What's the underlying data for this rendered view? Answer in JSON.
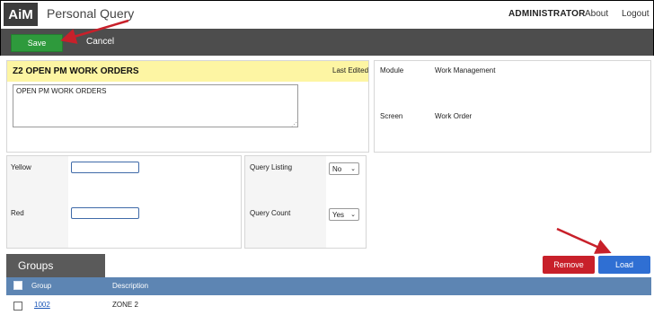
{
  "app": {
    "logo": "AiM",
    "title": "Personal Query",
    "user": "ADMINISTRATOR",
    "links": [
      "About",
      "Logout"
    ]
  },
  "toolbar": {
    "save_label": "Save",
    "cancel_label": "Cancel"
  },
  "query": {
    "title": "Z2 OPEN PM WORK ORDERS",
    "last_edited_label": "Last Edited",
    "description": "OPEN PM WORK ORDERS"
  },
  "module_panel": {
    "module_label": "Module",
    "module_value": "Work Management",
    "screen_label": "Screen",
    "screen_value": "Work Order"
  },
  "thresholds": {
    "yellow_label": "Yellow",
    "yellow_value": "",
    "red_label": "Red",
    "red_value": ""
  },
  "options": {
    "listing_label": "Query Listing",
    "listing_value": "No",
    "count_label": "Query Count",
    "count_value": "Yes"
  },
  "groups": {
    "tab_label": "Groups",
    "remove_label": "Remove",
    "load_label": "Load",
    "columns": [
      "Group",
      "Description"
    ],
    "rows": [
      {
        "group": "1002",
        "description": "ZONE 2"
      }
    ]
  },
  "colors": {
    "save": "#2e9a3c",
    "remove": "#c8202a",
    "load": "#2f6fd3",
    "header_yellow": "#fdf5a3",
    "table_header": "#5d85b3",
    "annotation_arrow": "#c8202a"
  }
}
